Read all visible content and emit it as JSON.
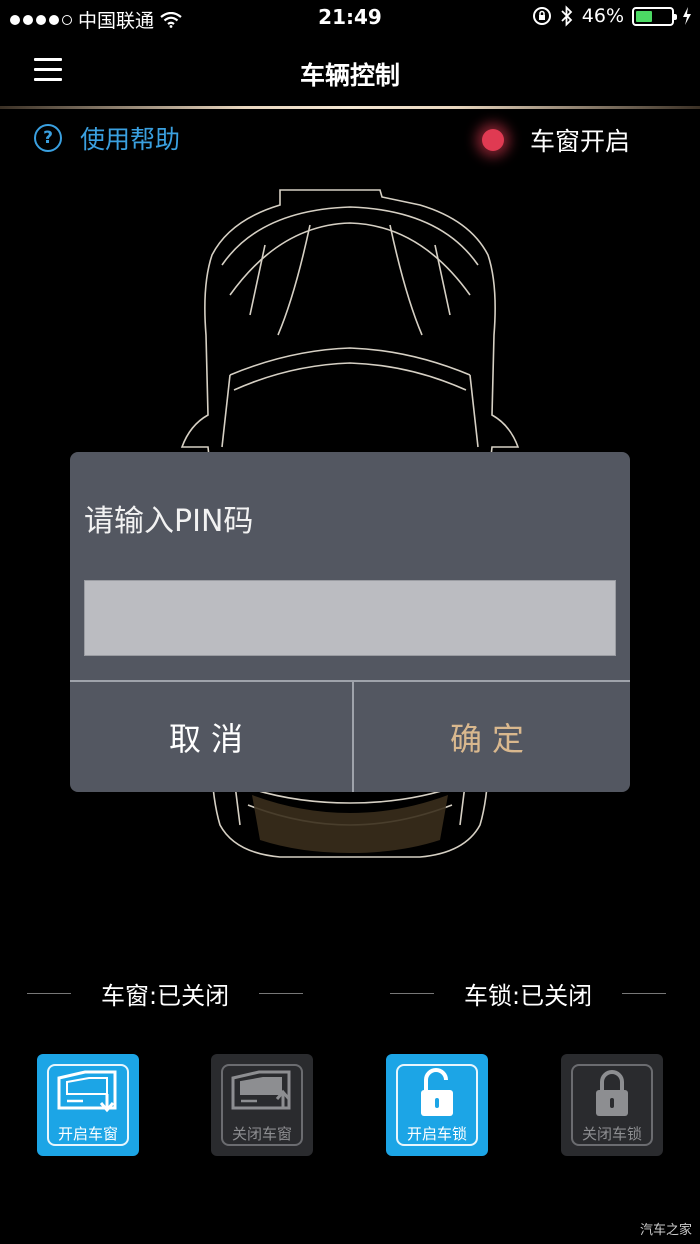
{
  "status_bar": {
    "carrier": "中国联通",
    "time": "21:49",
    "battery_pct": "46%",
    "battery_level": 0.46
  },
  "nav": {
    "title": "车辆控制"
  },
  "help": {
    "label": "使用帮助"
  },
  "window_alert": {
    "label": "车窗开启",
    "color": "#e03a52"
  },
  "dialog": {
    "title": "请输入PIN码",
    "input_value": "",
    "cancel_label": "取消",
    "ok_label": "确定"
  },
  "status": {
    "window_label": "车窗:已关闭",
    "lock_label": "车锁:已关闭"
  },
  "controls": [
    {
      "label": "开启车窗",
      "icon": "window-open-icon",
      "state": "active"
    },
    {
      "label": "关闭车窗",
      "icon": "window-close-icon",
      "state": "disabled"
    },
    {
      "label": "开启车锁",
      "icon": "unlock-icon",
      "state": "active"
    },
    {
      "label": "关闭车锁",
      "icon": "lock-icon",
      "state": "disabled"
    }
  ],
  "colors": {
    "accent_blue": "#1ca5e6",
    "help_blue": "#3aa0e0",
    "ok_gold": "#d9b88e",
    "dialog_bg": "#535761"
  },
  "watermark": "汽车之家"
}
